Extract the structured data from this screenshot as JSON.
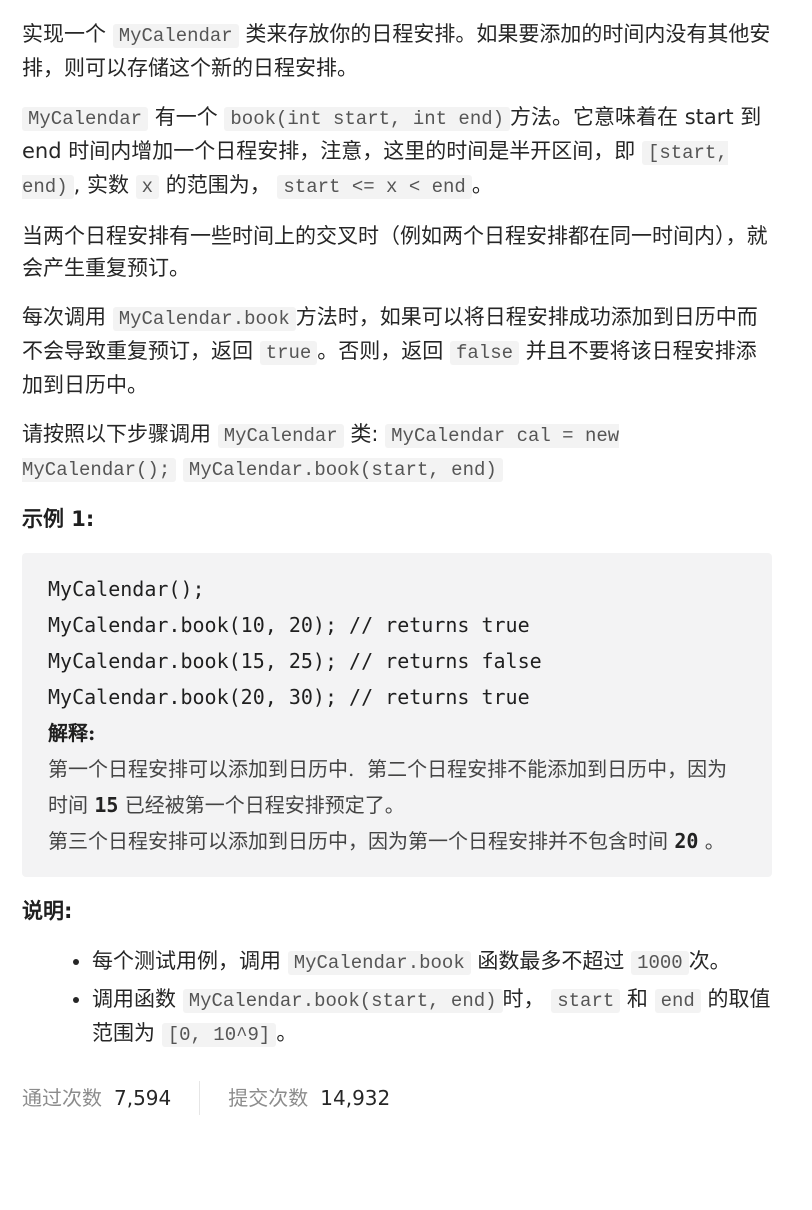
{
  "intro": {
    "p1_before": "实现一个 ",
    "p1_code": "MyCalendar",
    "p1_after": " 类来存放你的日程安排。如果要添加的时间内没有其他安排，则可以存储这个新的日程安排。",
    "p2_code1": "MyCalendar",
    "p2_text1": " 有一个 ",
    "p2_code2": "book(int start, int end)",
    "p2_text2": "方法。它意味着在 start 到 end 时间内增加一个日程安排，注意，这里的时间是半开区间，即 ",
    "p2_code3": "[start, end)",
    "p2_text3": ", 实数 ",
    "p2_code4": "x",
    "p2_text4": " 的范围为，  ",
    "p2_code5": "start <= x < end",
    "p2_text5": "。",
    "p3": "当两个日程安排有一些时间上的交叉时（例如两个日程安排都在同一时间内），就会产生重复预订。",
    "p4_text1": "每次调用 ",
    "p4_code1": "MyCalendar.book",
    "p4_text2": "方法时，如果可以将日程安排成功添加到日历中而不会导致重复预订，返回 ",
    "p4_code2": "true",
    "p4_text3": "。否则，返回 ",
    "p4_code3": "false",
    "p4_text4": " 并且不要将该日程安排添加到日历中。",
    "p5_text1": "请按照以下步骤调用 ",
    "p5_code1": "MyCalendar",
    "p5_text2": " 类: ",
    "p5_code2": "MyCalendar cal = new MyCalendar();",
    "p5_code3": "MyCalendar.book(start, end)"
  },
  "example": {
    "heading": "示例 1:",
    "lines": [
      "MyCalendar();",
      "MyCalendar.book(10, 20); // returns true",
      "MyCalendar.book(15, 25); // returns false",
      "MyCalendar.book(20, 30); // returns true"
    ],
    "explain_title": "解释:",
    "explain1_a": "第一个日程安排可以添加到日历中.  第二个日程安排不能添加到日历中，因为时间 ",
    "explain1_num": "15",
    "explain1_b": " 已经被第一个日程安排预定了。",
    "explain2_a": "第三个日程安排可以添加到日历中，因为第一个日程安排并不包含时间 ",
    "explain2_num": "20",
    "explain2_b": " 。"
  },
  "notes": {
    "heading": "说明:",
    "item1_text1": "每个测试用例，调用 ",
    "item1_code1": "MyCalendar.book",
    "item1_text2": " 函数最多不超过 ",
    "item1_code2": "1000",
    "item1_text3": "次。",
    "item2_text1": "调用函数 ",
    "item2_code1": "MyCalendar.book(start, end)",
    "item2_text2": "时， ",
    "item2_code2": "start",
    "item2_text3": " 和 ",
    "item2_code3": "end",
    "item2_text4": " 的取值范围为 ",
    "item2_code4": "[0, 10^9]",
    "item2_text5": "。"
  },
  "stats": {
    "accepted_label": "通过次数",
    "accepted_value": "7,594",
    "submitted_label": "提交次数",
    "submitted_value": "14,932"
  }
}
